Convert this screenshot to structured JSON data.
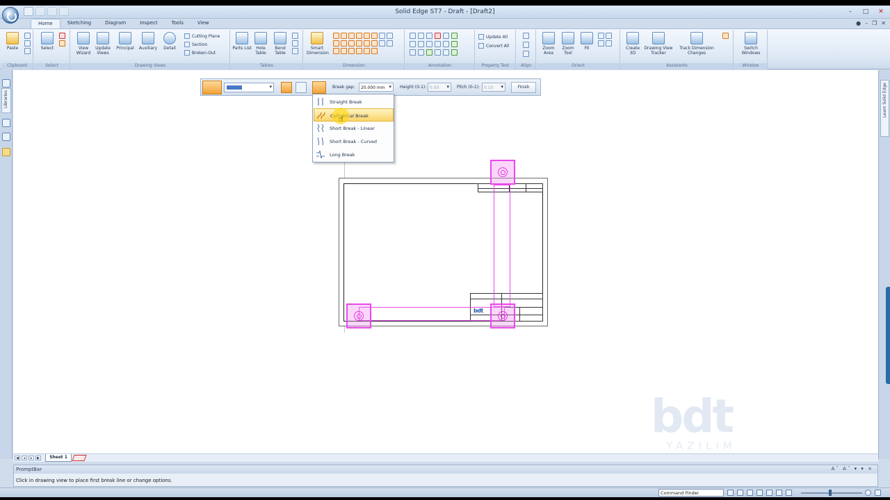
{
  "window": {
    "title": "Solid Edge ST7 - Draft - [Draft2]"
  },
  "tabs": [
    "Home",
    "Sketching",
    "Diagram",
    "Inspect",
    "Tools",
    "View"
  ],
  "ribbon": {
    "groups": [
      "Clipboard",
      "Select",
      "Drawing Views",
      "Tables",
      "Dimension",
      "Annotation",
      "Property Text",
      "Align",
      "Orient",
      "Assistants",
      "Window"
    ],
    "buttons": {
      "paste": "Paste",
      "select": "Select",
      "view_wizard": "View Wizard",
      "update_views": "Update Views",
      "principal": "Principal",
      "auxiliary": "Auxiliary",
      "detail": "Detail",
      "cutting_plane": "Cutting Plane",
      "section": "Section",
      "broken_out": "Broken-Out",
      "parts_list": "Parts List",
      "hole_table": "Hole Table",
      "bend_table": "Bend Table",
      "smart_dimension": "Smart Dimension",
      "update_all": "Update All",
      "convert_all": "Convert All",
      "zoom_area": "Zoom Area",
      "zoom_tool": "Zoom Tool",
      "fit": "Fit",
      "create_3d": "Create 3D",
      "drawing_view_tracker": "Drawing View Tracker",
      "track_dimension_changes": "Track Dimension Changes",
      "switch_windows": "Switch Windows"
    }
  },
  "side_panels": {
    "left_tab": "Libraries",
    "right_tab": "Learn Solid Edge"
  },
  "command_bar": {
    "line_style": "",
    "break_gap_label": "Break gap:",
    "break_gap_value": "20.000 mm",
    "height_label": "Height (0-1):",
    "height_value": "0.50",
    "pitch_label": "Pitch (0-1):",
    "pitch_value": "0.10",
    "finish_label": "Finish"
  },
  "break_menu": {
    "items": [
      "Straight Break",
      "Cylindrical Break",
      "Short Break - Linear",
      "Short Break - Curved",
      "Long Break"
    ],
    "highlighted": "Cylindrical Break"
  },
  "title_block": {
    "logo": "bdt"
  },
  "sheet_tabs": {
    "active": "Sheet 1"
  },
  "watermark": {
    "brand": "bdt",
    "subtitle": "YAZILIM"
  },
  "prompt_bar": {
    "title": "PromptBar",
    "tools": "Aˆ Aˇ ▾ ▾ ×",
    "message": "Click in drawing view to place first break line or change options."
  },
  "status_bar": {
    "command_finder": "Command Finder"
  },
  "colors": {
    "accent": "#2c6aa8",
    "highlight": "#fbd46a",
    "selection": "#ea48ea",
    "command_orange": "#f1a239"
  }
}
